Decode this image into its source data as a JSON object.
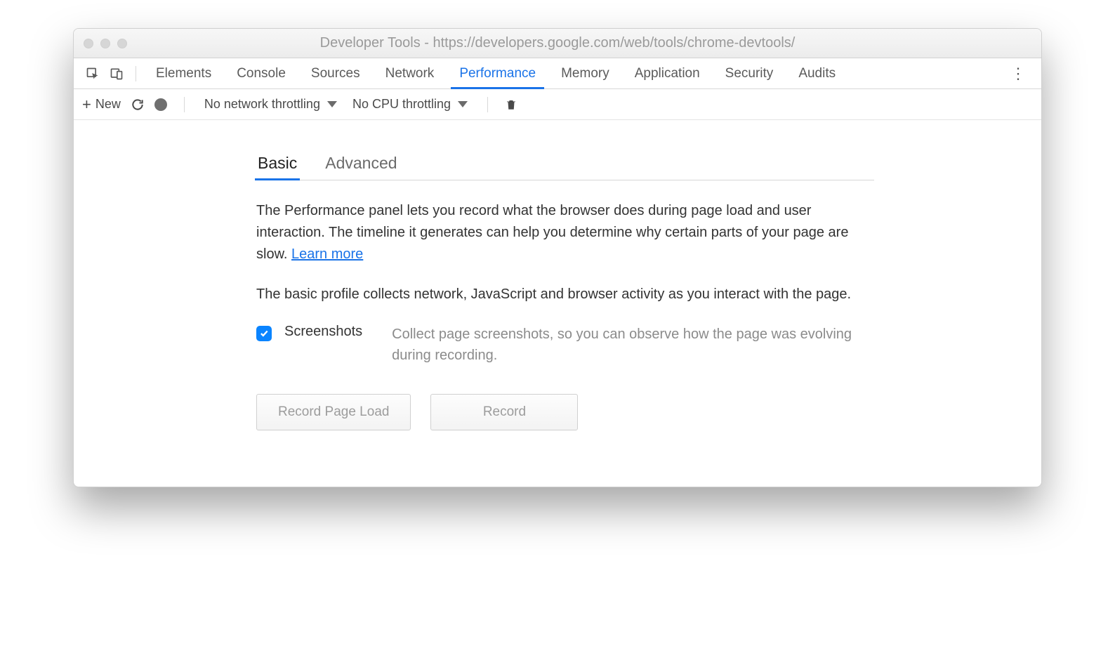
{
  "window_title": "Developer Tools - https://developers.google.com/web/tools/chrome-devtools/",
  "tabs": [
    "Elements",
    "Console",
    "Sources",
    "Network",
    "Performance",
    "Memory",
    "Application",
    "Security",
    "Audits"
  ],
  "active_tab": "Performance",
  "toolbar": {
    "new_label": "New",
    "network_throttle": "No network throttling",
    "cpu_throttle": "No CPU throttling"
  },
  "subtabs": [
    "Basic",
    "Advanced"
  ],
  "active_subtab": "Basic",
  "intro_text": "The Performance panel lets you record what the browser does during page load and user interaction. The timeline it generates can help you determine why certain parts of your page are slow.  ",
  "learn_more": "Learn more",
  "basic_text": "The basic profile collects network, JavaScript and browser activity as you interact with the page.",
  "option": {
    "label": "Screenshots",
    "description": "Collect page screenshots, so you can observe how the page was evolving during recording.",
    "checked": true
  },
  "buttons": {
    "record_page_load": "Record Page Load",
    "record": "Record"
  }
}
